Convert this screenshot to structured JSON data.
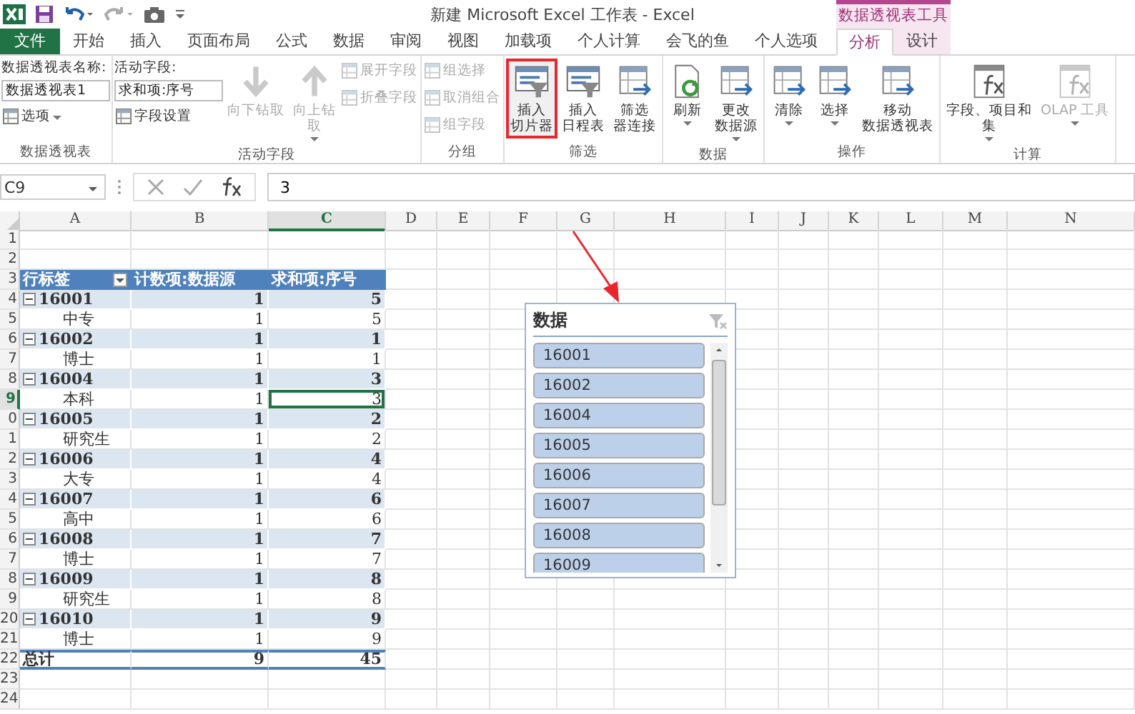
{
  "title_bar": {
    "title": "新建 Microsoft Excel 工作表 - Excel",
    "context_header": "数据透视表工具"
  },
  "tabs": [
    {
      "label": "文件",
      "kind": "file",
      "selected": false
    },
    {
      "label": "开始",
      "kind": "normal",
      "selected": false
    },
    {
      "label": "插入",
      "kind": "normal",
      "selected": false
    },
    {
      "label": "页面布局",
      "kind": "normal",
      "selected": false
    },
    {
      "label": "公式",
      "kind": "normal",
      "selected": false
    },
    {
      "label": "数据",
      "kind": "normal",
      "selected": false
    },
    {
      "label": "审阅",
      "kind": "normal",
      "selected": false
    },
    {
      "label": "视图",
      "kind": "normal",
      "selected": false
    },
    {
      "label": "加载项",
      "kind": "normal",
      "selected": false
    },
    {
      "label": "个人计算",
      "kind": "normal",
      "selected": false
    },
    {
      "label": "会飞的鱼",
      "kind": "normal",
      "selected": false
    },
    {
      "label": "个人选项",
      "kind": "normal",
      "selected": false
    },
    {
      "label": "分析",
      "kind": "context",
      "selected": true
    },
    {
      "label": "设计",
      "kind": "context",
      "selected": false
    }
  ],
  "ribbon": [
    {
      "label": "数据透视表",
      "columns": [
        [
          {
            "kind": "label",
            "text": "数据透视表名称:"
          },
          {
            "kind": "field",
            "value": "数据透视表1"
          },
          {
            "kind": "small",
            "text": "选项",
            "dropdown": true,
            "disabled": false
          }
        ]
      ]
    },
    {
      "label": "活动字段",
      "columns": [
        [
          {
            "kind": "label",
            "text": "活动字段:"
          },
          {
            "kind": "field",
            "value": "求和项:序号"
          },
          {
            "kind": "small",
            "text": "字段设置",
            "dropdown": false,
            "disabled": false
          }
        ],
        [
          {
            "kind": "large",
            "lines": [
              "向下钻取"
            ],
            "dropdown": false,
            "disabled": true,
            "highlighted": false
          }
        ],
        [
          {
            "kind": "large",
            "lines": [
              "向上钻",
              "取"
            ],
            "dropdown": true,
            "disabled": true,
            "highlighted": false
          }
        ],
        [
          {
            "kind": "small",
            "text": "展开字段",
            "dropdown": false,
            "disabled": true
          },
          {
            "kind": "small",
            "text": "折叠字段",
            "dropdown": false,
            "disabled": true
          }
        ]
      ]
    },
    {
      "label": "分组",
      "columns": [
        [
          {
            "kind": "small",
            "text": "组选择",
            "dropdown": false,
            "disabled": true
          },
          {
            "kind": "small",
            "text": "取消组合",
            "dropdown": false,
            "disabled": true
          },
          {
            "kind": "small",
            "text": "组字段",
            "dropdown": false,
            "disabled": true
          }
        ]
      ]
    },
    {
      "label": "筛选",
      "columns": [
        [
          {
            "kind": "large",
            "lines": [
              "插入",
              "切片器"
            ],
            "dropdown": false,
            "disabled": false,
            "highlighted": true
          }
        ],
        [
          {
            "kind": "large",
            "lines": [
              "插入",
              "日程表"
            ],
            "dropdown": false,
            "disabled": false,
            "highlighted": false
          }
        ],
        [
          {
            "kind": "large",
            "lines": [
              "筛选",
              "器连接"
            ],
            "dropdown": false,
            "disabled": false,
            "highlighted": false
          }
        ]
      ]
    },
    {
      "label": "数据",
      "columns": [
        [
          {
            "kind": "large",
            "lines": [
              "刷新"
            ],
            "dropdown": true,
            "disabled": false,
            "highlighted": false
          }
        ],
        [
          {
            "kind": "large",
            "lines": [
              "更改",
              "数据源"
            ],
            "dropdown": true,
            "disabled": false,
            "highlighted": false
          }
        ]
      ]
    },
    {
      "label": "操作",
      "columns": [
        [
          {
            "kind": "large",
            "lines": [
              "清除"
            ],
            "dropdown": true,
            "disabled": false,
            "highlighted": false
          }
        ],
        [
          {
            "kind": "large",
            "lines": [
              "选择"
            ],
            "dropdown": true,
            "disabled": false,
            "highlighted": false
          }
        ],
        [
          {
            "kind": "large",
            "lines": [
              "移动",
              "数据透视表"
            ],
            "dropdown": false,
            "disabled": false,
            "highlighted": false
          }
        ]
      ]
    },
    {
      "label": "计算",
      "columns": [
        [
          {
            "kind": "large",
            "lines": [
              "字段、项目和",
              "集"
            ],
            "dropdown": true,
            "disabled": false,
            "highlighted": false
          }
        ],
        [
          {
            "kind": "large",
            "lines": [
              "OLAP 工具"
            ],
            "dropdown": true,
            "disabled": true,
            "highlighted": false
          }
        ]
      ]
    }
  ],
  "formula_bar": {
    "name_box": "C9",
    "value": "3"
  },
  "columns": [
    {
      "label": "A",
      "selected": false
    },
    {
      "label": "B",
      "selected": false
    },
    {
      "label": "C",
      "selected": true
    },
    {
      "label": "D",
      "selected": false
    },
    {
      "label": "E",
      "selected": false
    },
    {
      "label": "F",
      "selected": false
    },
    {
      "label": "G",
      "selected": false
    },
    {
      "label": "H",
      "selected": false
    },
    {
      "label": "I",
      "selected": false
    },
    {
      "label": "J",
      "selected": false
    },
    {
      "label": "K",
      "selected": false
    },
    {
      "label": "L",
      "selected": false
    },
    {
      "label": "M",
      "selected": false
    },
    {
      "label": "N",
      "selected": false
    }
  ],
  "rows": [
    {
      "number": "1",
      "selected": false,
      "kind": "empty"
    },
    {
      "number": "2",
      "selected": false,
      "kind": "empty"
    },
    {
      "number": "3",
      "selected": false,
      "kind": "header",
      "cells": [
        "行标签",
        "计数项:数据源",
        "求和项:序号"
      ]
    },
    {
      "number": "4",
      "selected": false,
      "kind": "group",
      "expanded": true,
      "cells": [
        "16001",
        "1",
        "5"
      ]
    },
    {
      "number": "5",
      "selected": false,
      "kind": "item",
      "cells": [
        "中专",
        "1",
        "5"
      ]
    },
    {
      "number": "6",
      "selected": false,
      "kind": "group",
      "expanded": true,
      "cells": [
        "16002",
        "1",
        "1"
      ]
    },
    {
      "number": "7",
      "selected": false,
      "kind": "item",
      "cells": [
        "博士",
        "1",
        "1"
      ]
    },
    {
      "number": "8",
      "selected": false,
      "kind": "group",
      "expanded": true,
      "cells": [
        "16004",
        "1",
        "3"
      ]
    },
    {
      "number": "9",
      "selected": true,
      "kind": "item",
      "cells": [
        "本科",
        "1",
        "3"
      ]
    },
    {
      "number": "0",
      "selected": false,
      "kind": "group",
      "expanded": true,
      "cells": [
        "16005",
        "1",
        "2"
      ]
    },
    {
      "number": "1",
      "selected": false,
      "kind": "item",
      "cells": [
        "研究生",
        "1",
        "2"
      ]
    },
    {
      "number": "2",
      "selected": false,
      "kind": "group",
      "expanded": true,
      "cells": [
        "16006",
        "1",
        "4"
      ]
    },
    {
      "number": "3",
      "selected": false,
      "kind": "item",
      "cells": [
        "大专",
        "1",
        "4"
      ]
    },
    {
      "number": "4",
      "selected": false,
      "kind": "group",
      "expanded": true,
      "cells": [
        "16007",
        "1",
        "6"
      ]
    },
    {
      "number": "5",
      "selected": false,
      "kind": "item",
      "cells": [
        "高中",
        "1",
        "6"
      ]
    },
    {
      "number": "6",
      "selected": false,
      "kind": "group",
      "expanded": true,
      "cells": [
        "16008",
        "1",
        "7"
      ]
    },
    {
      "number": "7",
      "selected": false,
      "kind": "item",
      "cells": [
        "博士",
        "1",
        "7"
      ]
    },
    {
      "number": "8",
      "selected": false,
      "kind": "group",
      "expanded": true,
      "cells": [
        "16009",
        "1",
        "8"
      ]
    },
    {
      "number": "9",
      "selected": false,
      "kind": "item",
      "cells": [
        "研究生",
        "1",
        "8"
      ]
    },
    {
      "number": "20",
      "selected": false,
      "kind": "group",
      "expanded": true,
      "cells": [
        "16010",
        "1",
        "9"
      ]
    },
    {
      "number": "21",
      "selected": false,
      "kind": "item",
      "cells": [
        "博士",
        "1",
        "9"
      ]
    },
    {
      "number": "22",
      "selected": false,
      "kind": "total",
      "cells": [
        "总计",
        "9",
        "45"
      ]
    },
    {
      "number": "23",
      "selected": false,
      "kind": "empty"
    },
    {
      "number": "24",
      "selected": false,
      "kind": "empty"
    }
  ],
  "slicer": {
    "title": "数据",
    "items": [
      {
        "label": "16001",
        "selected": true
      },
      {
        "label": "16002",
        "selected": true
      },
      {
        "label": "16004",
        "selected": true
      },
      {
        "label": "16005",
        "selected": true
      },
      {
        "label": "16006",
        "selected": true
      },
      {
        "label": "16007",
        "selected": true
      },
      {
        "label": "16008",
        "selected": true
      },
      {
        "label": "16009",
        "selected": true
      }
    ]
  }
}
